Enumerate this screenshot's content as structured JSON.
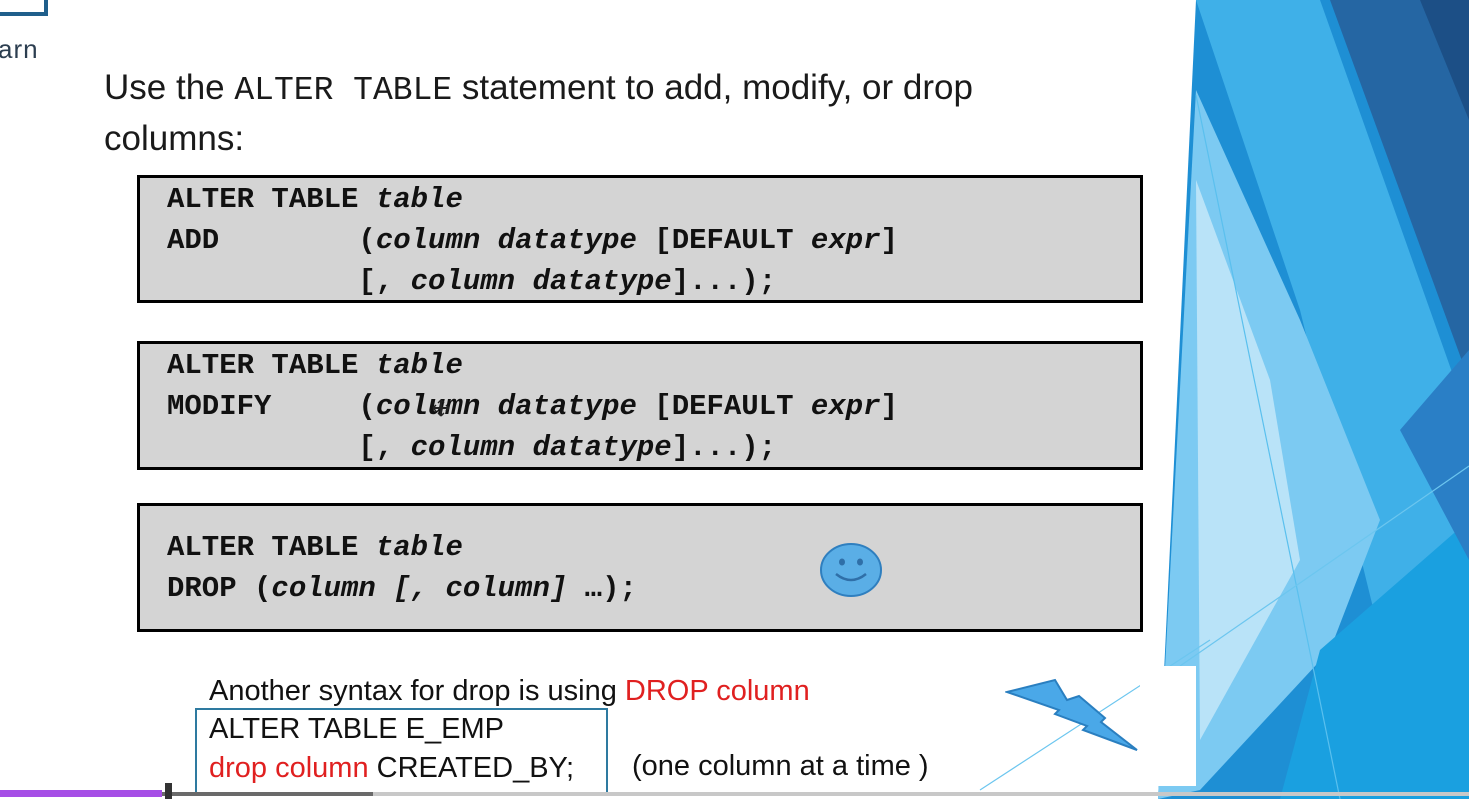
{
  "logo": {
    "text": "arn"
  },
  "intro": {
    "prefix": "Use the ",
    "keyword": "ALTER TABLE",
    "suffix": " statement to add, modify, or drop",
    "line2": "columns:"
  },
  "add_box": {
    "l1_kw": "ALTER TABLE ",
    "l1_it": "table",
    "l2_kw": "ADD        (",
    "l2_it1": "column datatype",
    "l2_mid": " [DEFAULT ",
    "l2_it2": "expr",
    "l2_end": "]",
    "l3_pre": "           [, ",
    "l3_it": "column datatype",
    "l3_end": "]...);"
  },
  "modify_box": {
    "l1_kw": "ALTER TABLE ",
    "l1_it": "table",
    "l2_kw": "MODIFY     (",
    "l2_it1": "column datatype",
    "l2_mid": " [DEFAULT ",
    "l2_it2": "expr",
    "l2_end": "]",
    "l3_pre": "           [, ",
    "l3_it": "column datatype",
    "l3_end": "]...);"
  },
  "drop_box": {
    "l1_kw": "ALTER TABLE ",
    "l1_it": "table",
    "l2_kw": "DROP (",
    "l2_it": "column [, column]",
    "l2_end": " …);"
  },
  "note": {
    "text": "Another syntax for drop is using ",
    "highlight": "DROP column",
    "sql_line1": "ALTER TABLE E_EMP",
    "sql_red": "drop column",
    "sql_rest": " CREATED_BY;",
    "hint": "(one column at a time )"
  },
  "player": {
    "progress": 0.11
  },
  "colors": {
    "accent_red": "#e02020",
    "code_bg": "#d4d4d4",
    "progress_purple": "#a64ee6",
    "smiley": "#5aaee6",
    "lightning": "#4aa8e8"
  },
  "icons": [
    "smiley-icon",
    "lightning-icon",
    "cursor-icon"
  ]
}
